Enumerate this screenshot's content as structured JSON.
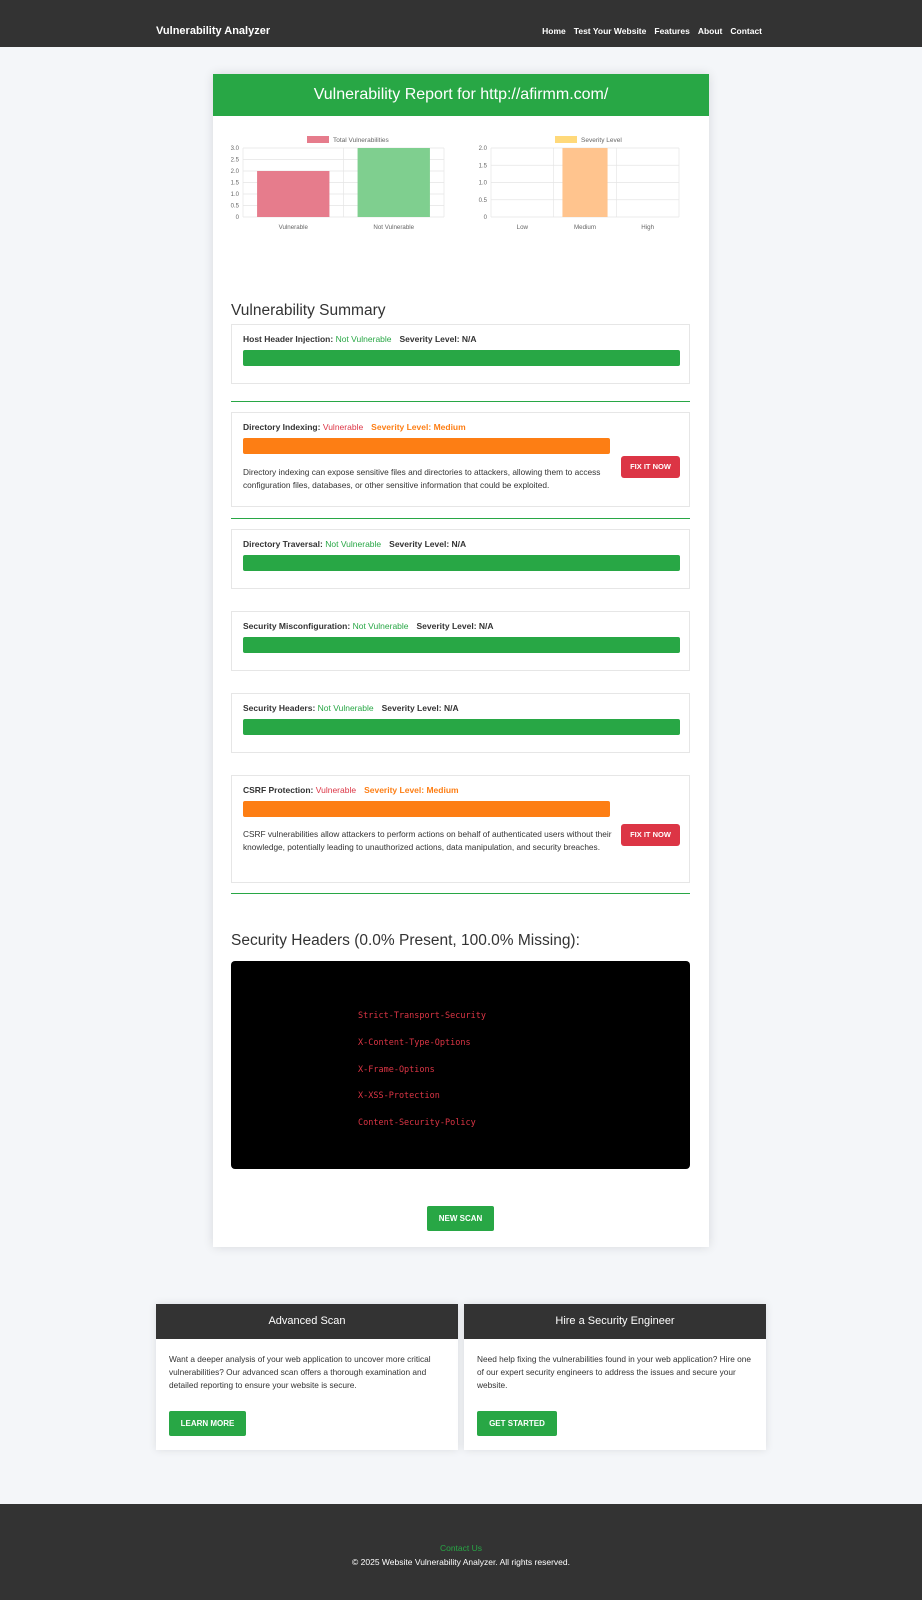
{
  "nav": {
    "brand": "Vulnerability Analyzer",
    "links": [
      "Home",
      "Test Your Website",
      "Features",
      "About",
      "Contact"
    ]
  },
  "report": {
    "title": "Vulnerability Report for http://afirmm.com/"
  },
  "chart_data": [
    {
      "type": "bar",
      "categories": [
        "Vulnerable",
        "Not Vulnerable"
      ],
      "series": [
        {
          "name": "Total Vulnerabilities",
          "values": [
            2,
            3
          ]
        }
      ],
      "ylim": [
        0,
        3.0
      ],
      "yticks": [
        "0",
        "0.5",
        "1.0",
        "1.5",
        "2.0",
        "2.5",
        "3.0"
      ],
      "colors": [
        "#e67c8c",
        "#7fcf8f"
      ],
      "legend": "top"
    },
    {
      "type": "bar",
      "categories": [
        "Low",
        "Medium",
        "High"
      ],
      "series": [
        {
          "name": "Severity Level",
          "values": [
            0,
            2,
            0
          ]
        }
      ],
      "ylim": [
        0,
        2.0
      ],
      "yticks": [
        "0",
        "0.5",
        "1.0",
        "1.5",
        "2.0"
      ],
      "colors": [
        "#ffc48e"
      ],
      "legend_color": "#ffd97a",
      "legend": "top"
    }
  ],
  "summary": {
    "title": "Vulnerability Summary",
    "severity_label": "Severity Level:",
    "items": [
      {
        "name": "Host Header Injection:",
        "status": "Not Vulnerable",
        "severity": "N/A"
      },
      {
        "name": "Directory Indexing:",
        "status": "Vulnerable",
        "severity": "Medium",
        "description": "Directory indexing can expose sensitive files and directories to attackers, allowing them to access configuration files, databases, or other sensitive information that could be exploited.",
        "fix_label": "FIX IT NOW"
      },
      {
        "name": "Directory Traversal:",
        "status": "Not Vulnerable",
        "severity": "N/A"
      },
      {
        "name": "Security Misconfiguration:",
        "status": "Not Vulnerable",
        "severity": "N/A"
      },
      {
        "name": "Security Headers:",
        "status": "Not Vulnerable",
        "severity": "N/A"
      },
      {
        "name": "CSRF Protection:",
        "status": "Vulnerable",
        "severity": "Medium",
        "description": "CSRF vulnerabilities allow attackers to perform actions on behalf of authenticated users without their knowledge, potentially leading to unauthorized actions, data manipulation, and security breaches.",
        "fix_label": "FIX IT NOW"
      }
    ]
  },
  "headers": {
    "title": "Security Headers (0.0% Present, 100.0% Missing):",
    "missing": [
      "Strict-Transport-Security",
      "X-Content-Type-Options",
      "X-Frame-Options",
      "X-XSS-Protection",
      "Content-Security-Policy"
    ]
  },
  "new_scan_label": "NEW SCAN",
  "promos": [
    {
      "title": "Advanced Scan",
      "text": "Want a deeper analysis of your web application to uncover more critical vulnerabilities? Our advanced scan offers a thorough examination and detailed reporting to ensure your website is secure.",
      "button": "LEARN MORE"
    },
    {
      "title": "Hire a Security Engineer",
      "text": "Need help fixing the vulnerabilities found in your web application? Hire one of our expert security engineers to address the issues and secure your website.",
      "button": "GET STARTED"
    }
  ],
  "footer": {
    "contact": "Contact Us",
    "copyright": "© 2025 Website Vulnerability Analyzer. All rights reserved."
  }
}
